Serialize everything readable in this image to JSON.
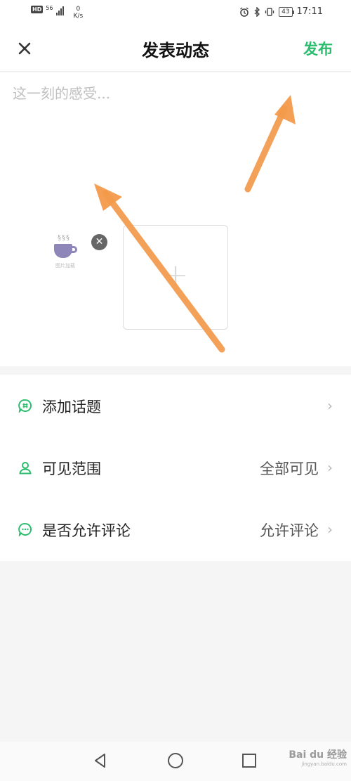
{
  "status_bar": {
    "hd": "HD",
    "network": "56",
    "speed_value": "0",
    "speed_unit": "K/s",
    "battery": "43",
    "time": "17:11"
  },
  "header": {
    "close_icon": "close-icon",
    "title": "发表动态",
    "publish_label": "发布",
    "accent_color": "#2bbd6e"
  },
  "composer": {
    "placeholder": "这一刻的感受...",
    "value": "",
    "attachment_caption": "图片加载",
    "add_label": "+"
  },
  "menu": {
    "items": [
      {
        "icon": "topic-icon",
        "label": "添加话题",
        "value": ""
      },
      {
        "icon": "user-icon",
        "label": "可见范围",
        "value": "全部可见"
      },
      {
        "icon": "comment-icon",
        "label": "是否允许评论",
        "value": "允许评论"
      }
    ]
  },
  "nav_bar": {
    "back": "back-icon",
    "home": "home-icon",
    "recent": "recent-apps-icon"
  },
  "watermark": {
    "brand": "Bai du 经验",
    "url": "jingyan.baidu.com"
  }
}
